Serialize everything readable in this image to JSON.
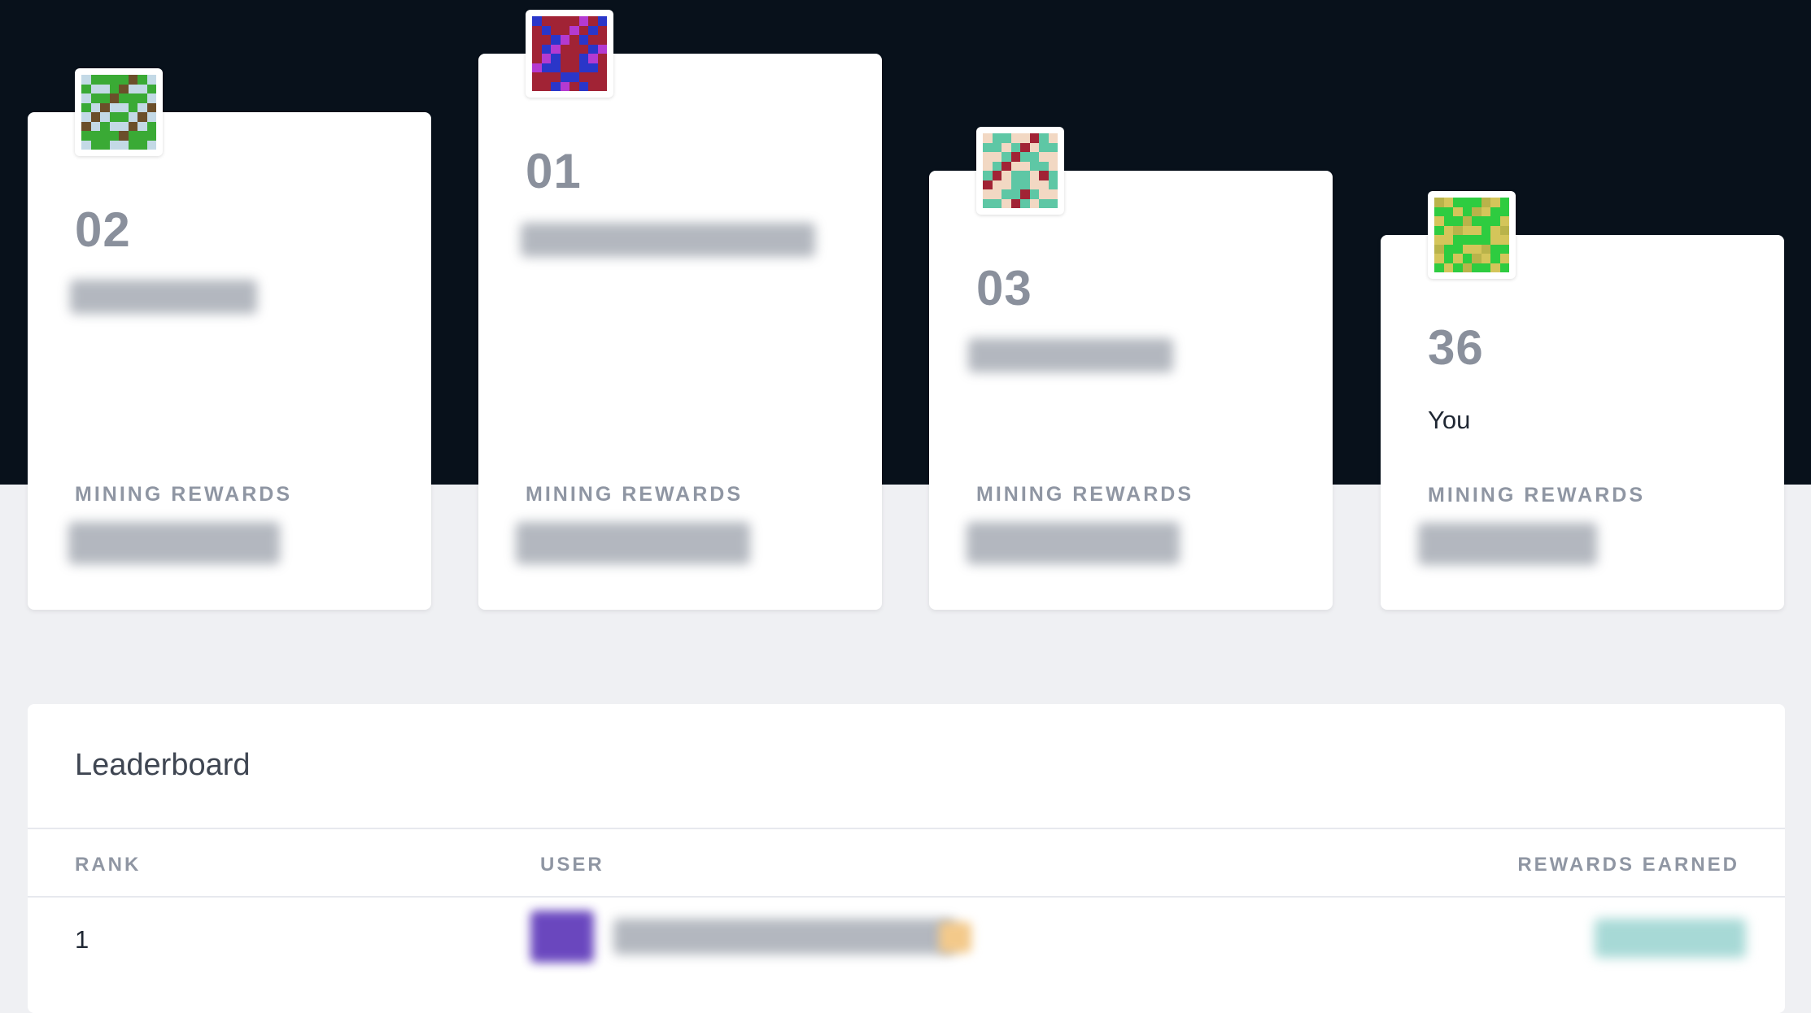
{
  "podium": [
    {
      "rank": "02",
      "name_text": "",
      "mining_label": "MINING REWARDS",
      "avatar_colors": [
        "#c3d9e6",
        "#3aaa35",
        "#6b4f2a"
      ]
    },
    {
      "rank": "01",
      "name_text": "",
      "mining_label": "MINING REWARDS",
      "avatar_colors": [
        "#2a36c9",
        "#a12335",
        "#b43ad1"
      ]
    },
    {
      "rank": "03",
      "name_text": "",
      "mining_label": "MINING REWARDS",
      "avatar_colors": [
        "#f2d8c3",
        "#5ec7a5",
        "#a12335"
      ]
    },
    {
      "rank": "36",
      "name_text": "You",
      "mining_label": "MINING REWARDS",
      "avatar_colors": [
        "#d4c55a",
        "#2ecc40",
        "#b9b34a"
      ]
    }
  ],
  "leaderboard": {
    "title": "Leaderboard",
    "columns": [
      "RANK",
      "USER",
      "REWARDS EARNED"
    ],
    "rows": [
      {
        "rank": "1"
      }
    ]
  },
  "colors": {
    "hero_bg": "#08111b",
    "page_bg": "#eff0f3",
    "card_bg": "#ffffff",
    "muted_text": "#8f96a3"
  }
}
